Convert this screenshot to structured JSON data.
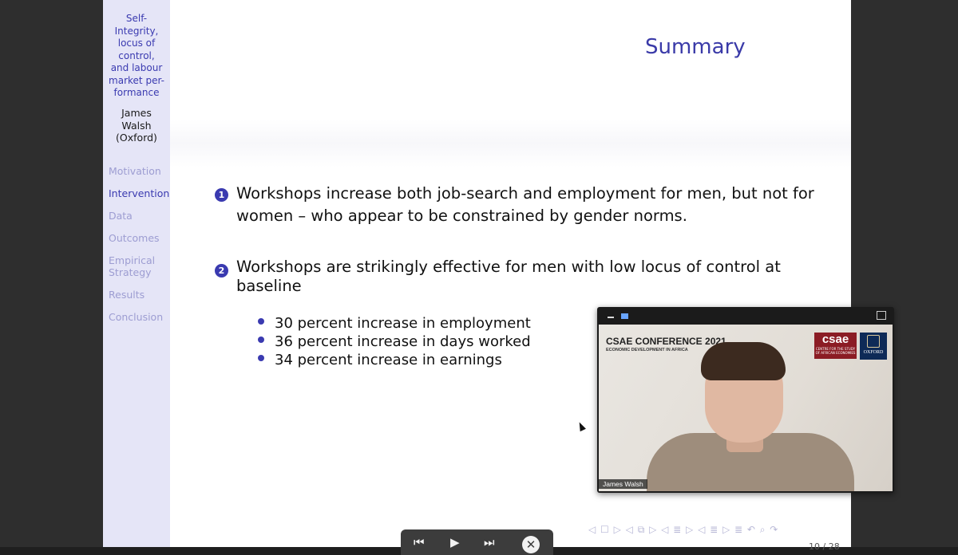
{
  "sidebar": {
    "title_lines": [
      "Self-",
      "Integrity,",
      "locus of",
      "control,",
      "and labour",
      "market per-",
      "formance"
    ],
    "author_lines": [
      "James",
      "Walsh",
      "(Oxford)"
    ],
    "nav": [
      "Motivation",
      "Intervention",
      "Data",
      "Outcomes",
      "Empirical",
      "Strategy",
      "Results",
      "Conclusion"
    ]
  },
  "slide": {
    "title": "Summary",
    "items": [
      {
        "number": "1",
        "lines": [
          "Workshops increase both job-search and employment for men, but not for",
          "women – who appear to be constrained by gender norms."
        ]
      },
      {
        "number": "2",
        "lines": [
          "Workshops are strikingly effective for men with low locus of control at",
          "baseline"
        ]
      }
    ],
    "bullets": [
      "30 percent increase in employment",
      "36 percent increase in days worked",
      "34 percent increase in earnings"
    ],
    "nav_symbols": "◁ ☐ ▷   ◁ ⧉ ▷   ◁ ≣ ▷   ◁ ≣ ▷    ≣    ↶ ⌕ ↷",
    "page_number": "10 / 28"
  },
  "video": {
    "conference": "CSAE CONFERENCE 2021",
    "subtitle": "ECONOMIC DEVELOPMENT IN AFRICA",
    "csae_logo": "csae",
    "csae_small": "CENTRE FOR THE STUDY OF AFRICAN ECONOMIES",
    "oxford_logo": "OXFORD",
    "speaker_name": "James Walsh"
  },
  "controls": {
    "prev": "⏮",
    "play": "▶",
    "next": "⏭",
    "close": "✕"
  }
}
